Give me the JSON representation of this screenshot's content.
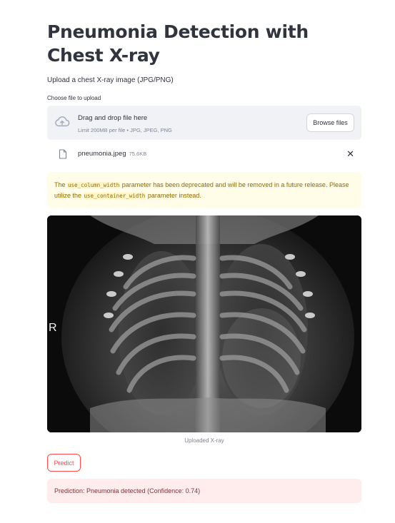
{
  "page": {
    "title": "Pneumonia Detection with Chest X-ray",
    "subtitle": "Upload a chest X-ray image (JPG/PNG)"
  },
  "uploader": {
    "label": "Choose file to upload",
    "dropzone_title": "Drag and drop file here",
    "dropzone_limit": "Limit 200MB per file • JPG, JPEG, PNG",
    "browse_label": "Browse files",
    "file_name": "pneumonia.jpeg",
    "file_size": "75.6KB",
    "close_glyph": "✕"
  },
  "warning": {
    "part1": "The ",
    "code1": "use_column_width",
    "part2": " parameter has been deprecated and will be removed in a future release. Please utilize the ",
    "code2": "use_container_width",
    "part3": " parameter instead."
  },
  "image": {
    "marker": "R",
    "caption": "Uploaded X-ray"
  },
  "predict": {
    "button_label": "Predict",
    "result_text": "Prediction: Pneumonia detected (Confidence: 0.74)"
  },
  "colors": {
    "primary": "#ff4b4b",
    "warning_bg": "#fffce7",
    "error_bg": "#ffecec",
    "dropzone_bg": "#f0f2f6"
  },
  "icons": [
    "cloud-upload-icon",
    "file-icon",
    "close-icon"
  ]
}
